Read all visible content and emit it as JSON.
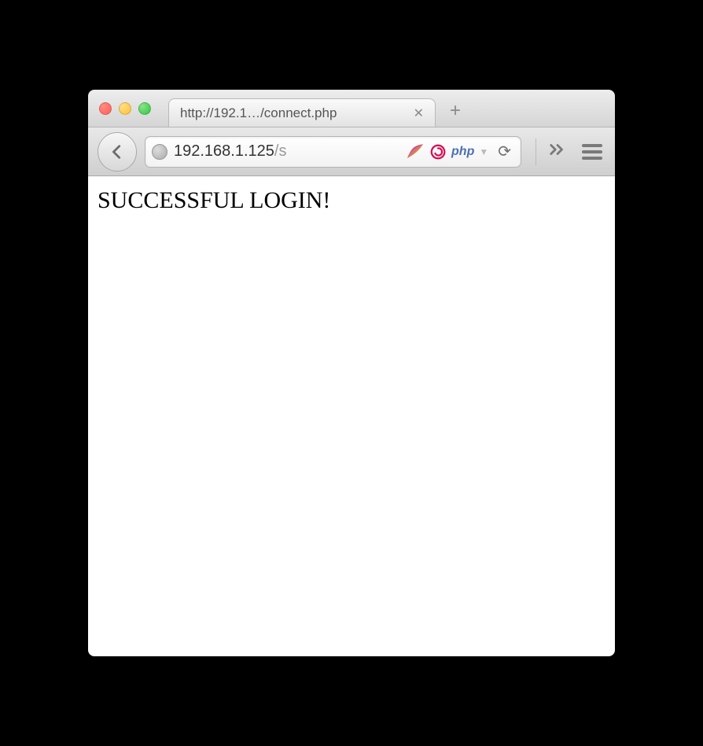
{
  "tab": {
    "title": "http://192.1…/connect.php"
  },
  "address": {
    "host": "192.168.1.125",
    "path": "/s"
  },
  "icons": {
    "php_label": "php"
  },
  "page": {
    "message": "SUCCESSFUL LOGIN!"
  }
}
